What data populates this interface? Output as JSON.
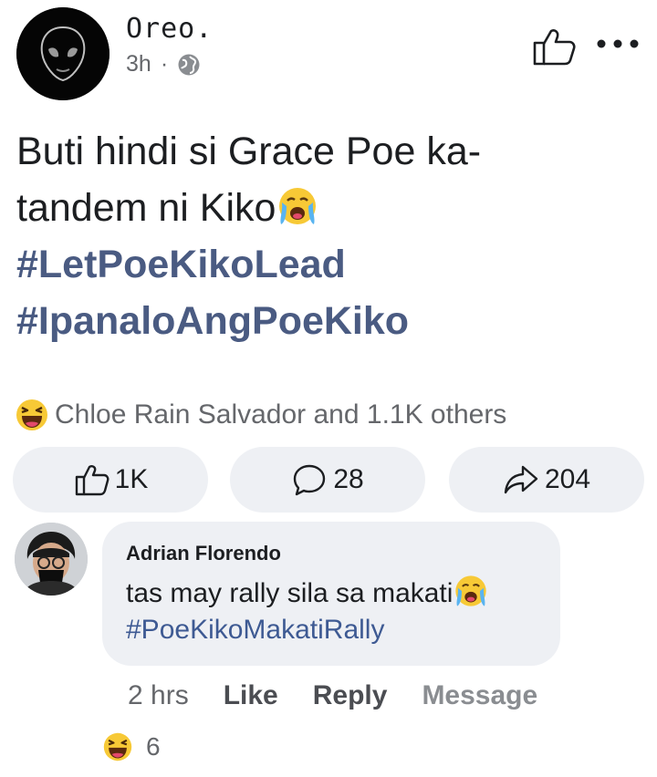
{
  "post": {
    "author": "Oreo.",
    "time": "3h",
    "separator": "·",
    "lines": [
      "Buti hindi si Grace Poe ka-",
      "tandem ni Kiko"
    ],
    "hashtags": [
      "#LetPoeKikoLead",
      "#IpanaloAngPoeKiko"
    ]
  },
  "reactions": {
    "summary": "Chloe Rain Salvador and 1.1K others",
    "like_count": "1K",
    "comment_count": "28",
    "share_count": "204"
  },
  "comment": {
    "author": "Adrian Florendo",
    "text": "tas may rally sila sa makati",
    "hashtag": "#PoeKikoMakatiRally",
    "time": "2 hrs",
    "like_label": "Like",
    "reply_label": "Reply",
    "message_label": "Message",
    "reaction_count": "6"
  },
  "colors": {
    "hashtag": "#4a5b82",
    "pill_bg": "#eef0f4",
    "muted": "#65676b"
  },
  "icons": [
    "globe-icon",
    "like-icon",
    "more-icon",
    "comment-icon",
    "share-icon",
    "crying-emoji-icon",
    "haha-emoji-icon"
  ]
}
